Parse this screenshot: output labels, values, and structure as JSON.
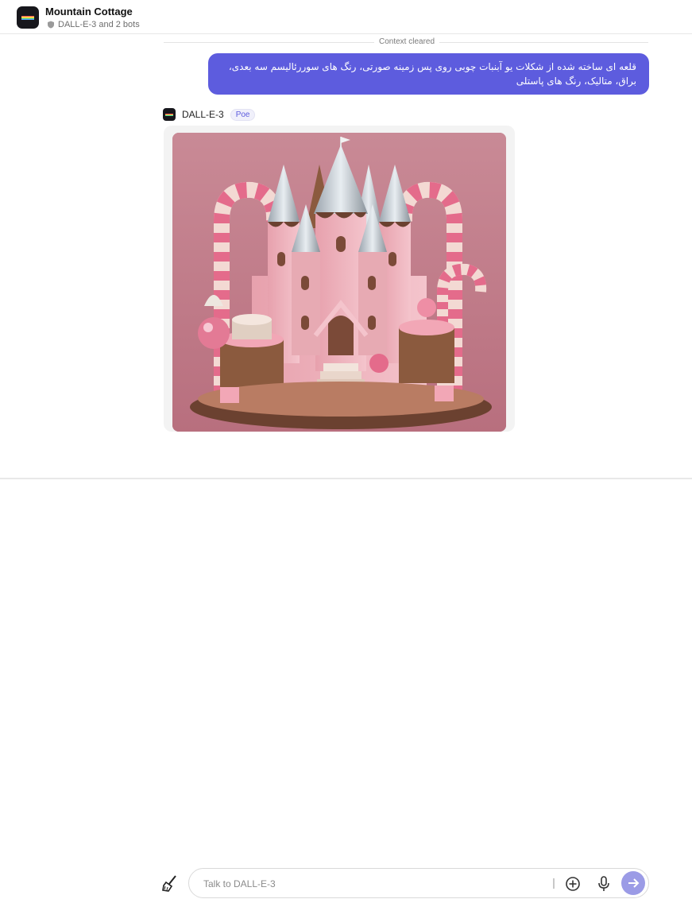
{
  "header": {
    "title": "Mountain Cottage",
    "subtitle": "DALL-E-3 and 2 bots"
  },
  "thread": {
    "context_label": "Context cleared",
    "user_message": "قلعه ای ساخته شده از شکلات یو آبنبات چوبی روی پس زمینه صورتی، رنگ های سوررئالیسم سه بعدی، براق، متالیک، رنگ های پاستلی",
    "bot_name": "DALL-E-3",
    "bot_badge": "Poe"
  },
  "composer": {
    "placeholder": "Talk to DALL-E-3"
  },
  "colors": {
    "accent": "#5d5cde",
    "send_disabled": "#9b9be6",
    "image_bg": "#c3808d"
  },
  "icons": {
    "clear_context": "broom-icon",
    "attach": "plus-circle-icon",
    "voice": "microphone-icon",
    "send": "arrow-right-icon"
  }
}
